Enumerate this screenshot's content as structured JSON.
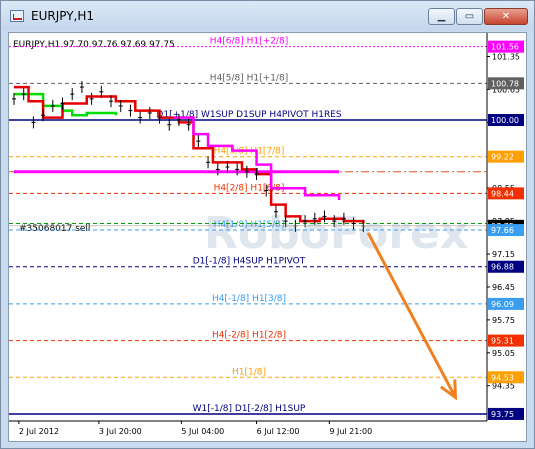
{
  "window": {
    "title": "EURJPY,H1",
    "minimize_label": "▁",
    "maximize_label": "▭",
    "close_label": "✕"
  },
  "chart_header": "EURJPY,H1  97.70 97.76 97.69 97.75",
  "watermark": "RoboForex",
  "order_label": "#35068017 sell",
  "colors": {
    "h1_line": "#ff00ff",
    "h4_line": "#e60000",
    "d1_line": "#00dd00",
    "candle": "#000000",
    "forecast_arrow": "#f08020",
    "base_line": "#000080"
  },
  "chart_data": {
    "type": "line",
    "symbol": "EURJPY",
    "timeframe": "H1",
    "ohlc_header": {
      "open": 97.7,
      "high": 97.76,
      "low": 97.69,
      "close": 97.75
    },
    "ylim": [
      93.6,
      101.85
    ],
    "x_ticks": [
      "2 Jul 2012",
      "3 Jul 20:00",
      "5 Jul 04:00",
      "6 Jul 12:00",
      "9 Jul 21:00"
    ],
    "y_ticks": [
      101.35,
      100.65,
      99.95,
      98.55,
      97.85,
      97.15,
      96.45,
      95.75,
      95.05,
      94.35
    ],
    "price_tags": [
      {
        "value": "101.56",
        "color": "#ff00ff",
        "text_color": "#ffffff"
      },
      {
        "value": "100.78",
        "color": "#606060",
        "text_color": "#ffffff"
      },
      {
        "value": "100.00",
        "color": "#000080",
        "text_color": "#ffffff"
      },
      {
        "value": "99.22",
        "color": "#ffa000",
        "text_color": "#ffffff"
      },
      {
        "value": "98.44",
        "color": "#f03000",
        "text_color": "#ffffff"
      },
      {
        "value": "97.75",
        "color": "#000000",
        "text_color": "#ffffff"
      },
      {
        "value": "97.66",
        "color": "#3a9ef0",
        "text_color": "#ffffff"
      },
      {
        "value": "96.88",
        "color": "#000080",
        "text_color": "#ffffff"
      },
      {
        "value": "96.09",
        "color": "#3a9ef0",
        "text_color": "#ffffff"
      },
      {
        "value": "95.31",
        "color": "#f03000",
        "text_color": "#ffffff"
      },
      {
        "value": "94.53",
        "color": "#ffa000",
        "text_color": "#ffffff"
      },
      {
        "value": "93.75",
        "color": "#000080",
        "text_color": "#ffffff"
      }
    ],
    "murrey_levels": [
      {
        "value": 101.56,
        "label": "H4[6/8] H1[+2/8]",
        "color": "#ff00ff",
        "style": "dotted"
      },
      {
        "value": 100.78,
        "label": "H4[5/8] H1[+1/8]",
        "color": "#606060",
        "style": "dashed"
      },
      {
        "value": 100.0,
        "label": "D1[+1/8] W1SUP D1SUP H4PIVOT H1RES",
        "color": "#000080",
        "style": "solid"
      },
      {
        "value": 99.22,
        "label": "H4[3/8] H1[7/8]",
        "color": "#ffa000",
        "style": "dashed"
      },
      {
        "value": 98.9,
        "label": "",
        "color": "#e05020",
        "style": "dashdot"
      },
      {
        "value": 98.44,
        "label": "H4[2/8] H1[6/8]",
        "color": "#f03000",
        "style": "dashed"
      },
      {
        "value": 97.66,
        "label": "H4[1/8] H1[5/8]",
        "color": "#3a9ef0",
        "style": "dashed"
      },
      {
        "value": 97.8,
        "label": "",
        "color": "#00a000",
        "style": "dashed"
      },
      {
        "value": 96.88,
        "label": "D1[-1/8] H4SUP H1PIVOT",
        "color": "#000080",
        "style": "dashed"
      },
      {
        "value": 96.09,
        "label": "H4[-1/8] H1[3/8]",
        "color": "#3a9ef0",
        "style": "dashed"
      },
      {
        "value": 95.31,
        "label": "H4[-2/8] H1[2/8]",
        "color": "#f03000",
        "style": "dashed"
      },
      {
        "value": 94.53,
        "label": "H1[1/8]",
        "color": "#ffa000",
        "style": "dashed"
      },
      {
        "value": 93.75,
        "label": "W1[-1/8] D1[-2/8] H1SUP",
        "color": "#000080",
        "style": "solid"
      }
    ],
    "price_series": [
      {
        "t": 0.0,
        "v": 100.45
      },
      {
        "t": 0.4,
        "v": 100.55
      },
      {
        "t": 0.8,
        "v": 99.95
      },
      {
        "t": 1.2,
        "v": 100.1
      },
      {
        "t": 1.6,
        "v": 100.3
      },
      {
        "t": 2.0,
        "v": 100.35
      },
      {
        "t": 2.4,
        "v": 100.55
      },
      {
        "t": 2.8,
        "v": 100.7
      },
      {
        "t": 3.2,
        "v": 100.45
      },
      {
        "t": 3.6,
        "v": 100.6
      },
      {
        "t": 4.0,
        "v": 100.4
      },
      {
        "t": 4.4,
        "v": 100.3
      },
      {
        "t": 4.8,
        "v": 100.2
      },
      {
        "t": 5.2,
        "v": 100.05
      },
      {
        "t": 5.6,
        "v": 100.15
      },
      {
        "t": 6.0,
        "v": 100.05
      },
      {
        "t": 6.4,
        "v": 99.9
      },
      {
        "t": 6.8,
        "v": 100.0
      },
      {
        "t": 7.2,
        "v": 99.9
      },
      {
        "t": 7.6,
        "v": 99.55
      },
      {
        "t": 8.0,
        "v": 99.1
      },
      {
        "t": 8.4,
        "v": 98.95
      },
      {
        "t": 8.8,
        "v": 99.0
      },
      {
        "t": 9.2,
        "v": 98.95
      },
      {
        "t": 9.6,
        "v": 98.9
      },
      {
        "t": 10.0,
        "v": 98.85
      },
      {
        "t": 10.4,
        "v": 98.5
      },
      {
        "t": 10.8,
        "v": 98.05
      },
      {
        "t": 11.2,
        "v": 97.85
      },
      {
        "t": 11.6,
        "v": 97.75
      },
      {
        "t": 12.0,
        "v": 97.85
      },
      {
        "t": 12.4,
        "v": 97.9
      },
      {
        "t": 12.8,
        "v": 97.95
      },
      {
        "t": 13.2,
        "v": 97.85
      },
      {
        "t": 13.6,
        "v": 97.9
      },
      {
        "t": 14.0,
        "v": 97.8
      },
      {
        "t": 14.4,
        "v": 97.75
      }
    ],
    "series": [
      {
        "values": [
          [
            0,
            100.55
          ],
          [
            1.2,
            100.3
          ],
          [
            2.0,
            100.2
          ],
          [
            2.4,
            100.1
          ],
          [
            3.0,
            100.15
          ],
          [
            3.8,
            100.15
          ],
          [
            4.2,
            100.1
          ]
        ],
        "color": "#00dd00"
      },
      {
        "values": [
          [
            0,
            100.7
          ],
          [
            0.6,
            100.4
          ],
          [
            1.2,
            100.05
          ],
          [
            2.0,
            100.35
          ],
          [
            3.0,
            100.5
          ],
          [
            4.2,
            100.4
          ],
          [
            5.0,
            100.2
          ],
          [
            6.0,
            100.05
          ],
          [
            6.8,
            99.95
          ],
          [
            7.4,
            99.4
          ],
          [
            8.2,
            99.1
          ],
          [
            9.4,
            98.95
          ],
          [
            10.0,
            98.85
          ],
          [
            10.6,
            98.2
          ],
          [
            11.2,
            97.95
          ],
          [
            11.8,
            97.85
          ],
          [
            12.6,
            97.9
          ],
          [
            13.6,
            97.85
          ],
          [
            14.4,
            97.8
          ]
        ],
        "color": "#e60000"
      },
      {
        "values": [
          [
            6.6,
            100.05
          ],
          [
            7.4,
            99.7
          ],
          [
            8.0,
            99.45
          ],
          [
            9.0,
            99.35
          ],
          [
            10.0,
            99.05
          ],
          [
            10.6,
            98.55
          ],
          [
            12.0,
            98.4
          ],
          [
            13.4,
            98.3
          ]
        ],
        "color": "#ff00ff"
      }
    ],
    "h1_bar": {
      "from": 0.0,
      "to": 13.4,
      "value": 98.9
    },
    "forecast_arrow": {
      "from": [
        14.6,
        97.6
      ],
      "to": [
        18.2,
        94.1
      ]
    },
    "t_max": 19.5
  }
}
